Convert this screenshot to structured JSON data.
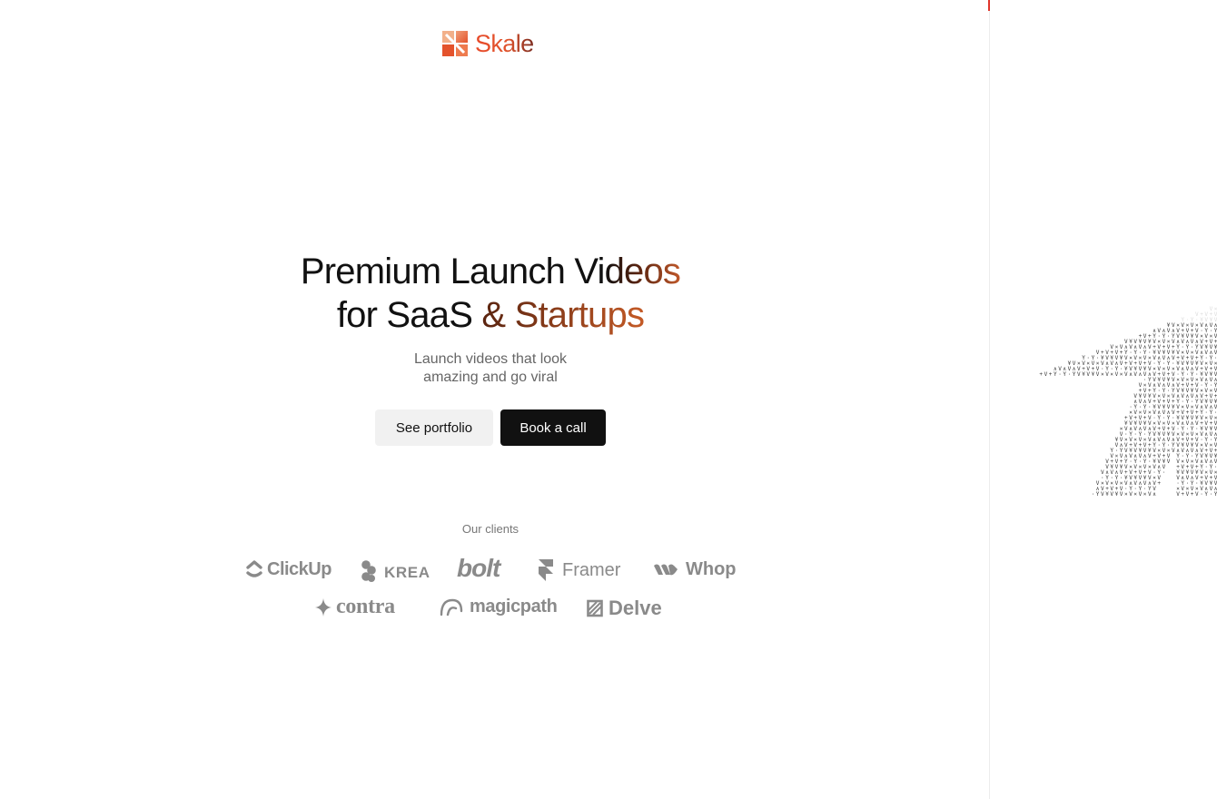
{
  "brand": {
    "name": "Skale",
    "accent": "#e84a2a"
  },
  "hero": {
    "line1_plain": "Premium Launch Vi",
    "line1_grad": "deos",
    "line2_plain": "for SaaS ",
    "line2_grad": "& Startups",
    "subtitle_line1": "Launch videos that look",
    "subtitle_line2": "amazing and go viral"
  },
  "actions": {
    "secondary_label": "See portfolio",
    "primary_label": "Book a call"
  },
  "clients": {
    "label": "Our clients",
    "logos": [
      "ClickUp",
      "KREA",
      "bolt",
      "Framer",
      "Whop",
      "contra",
      "magicpath",
      "Delve"
    ]
  },
  "colors": {
    "primary_button": "#111111",
    "secondary_button": "#f1f1f1",
    "logo_gray": "#8a8a8a",
    "gradient_end": "#c45a26"
  }
}
